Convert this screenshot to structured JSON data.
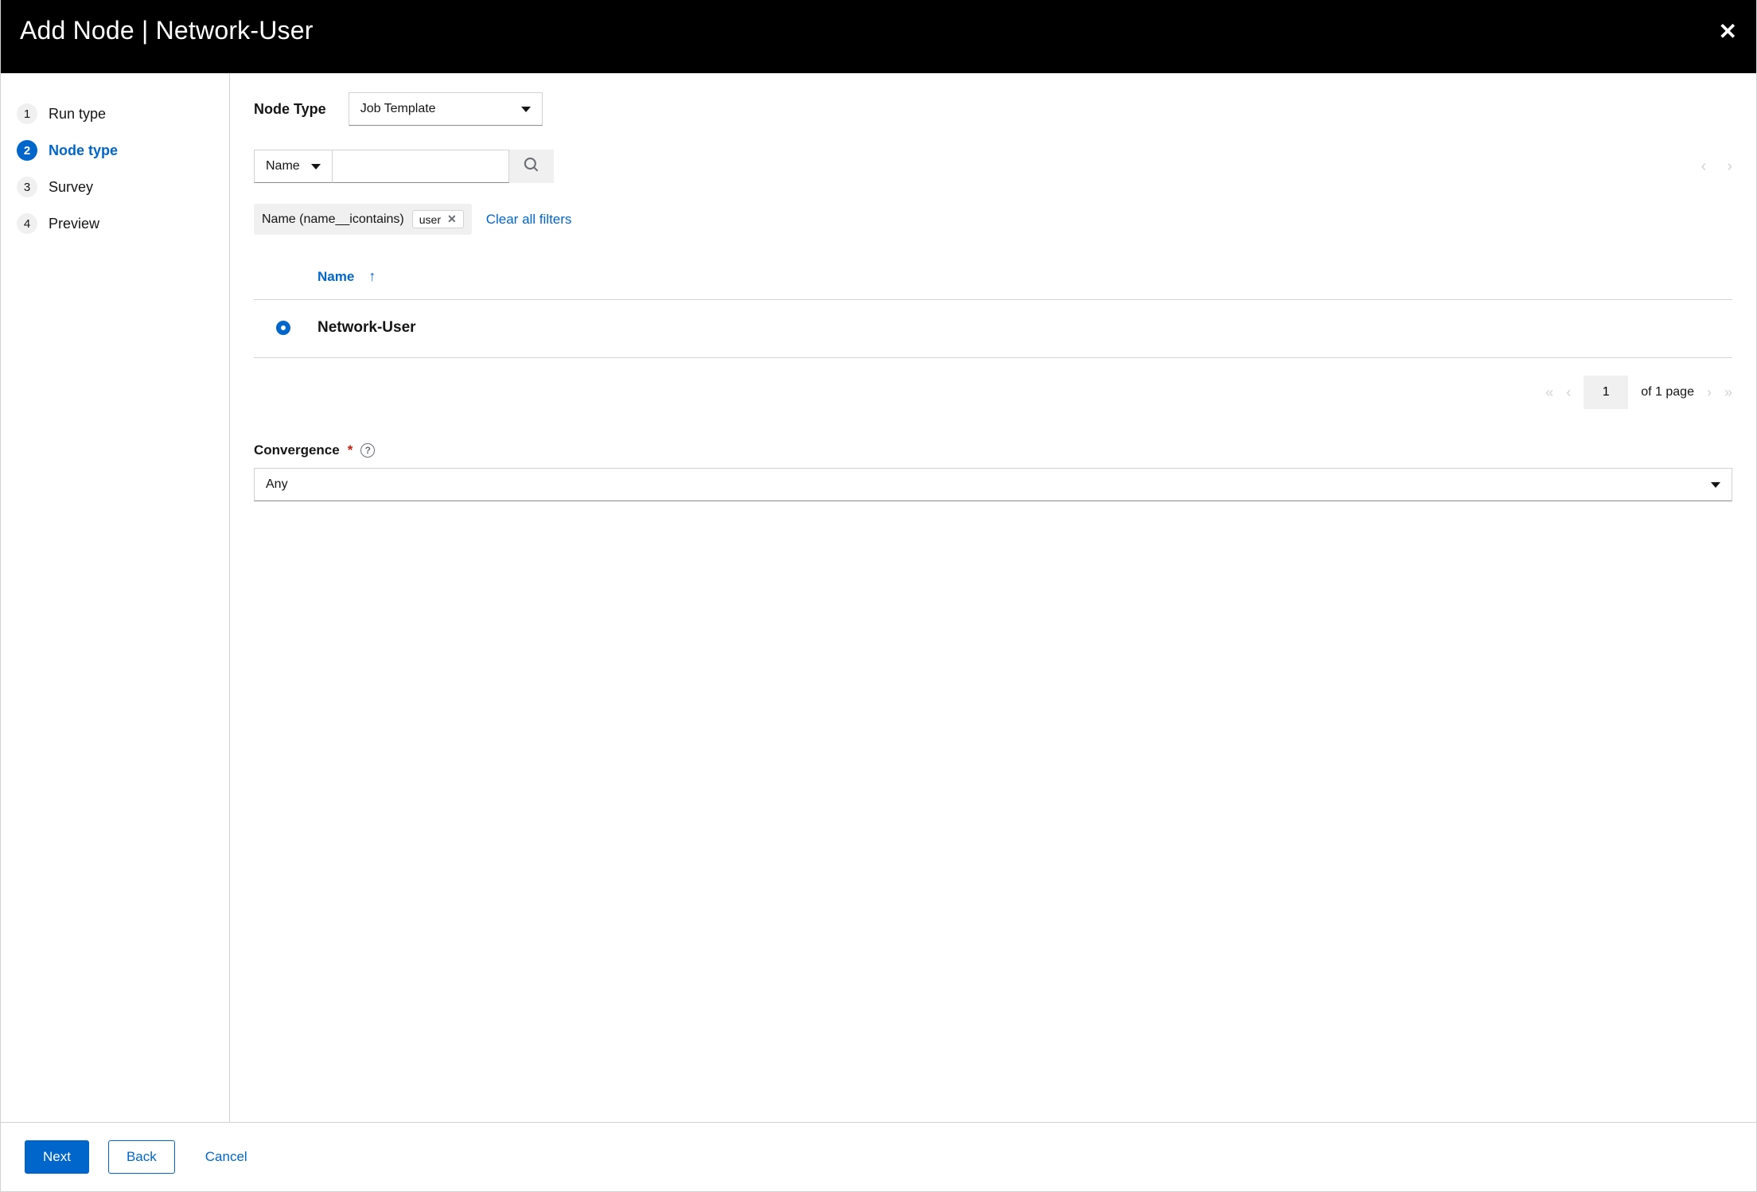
{
  "header": {
    "title": "Add Node | Network-User"
  },
  "wizard": {
    "steps": [
      {
        "num": "1",
        "label": "Run type"
      },
      {
        "num": "2",
        "label": "Node type"
      },
      {
        "num": "3",
        "label": "Survey"
      },
      {
        "num": "4",
        "label": "Preview"
      }
    ],
    "current_index": 1
  },
  "node_type": {
    "label": "Node Type",
    "value": "Job Template"
  },
  "search": {
    "key": "Name",
    "value": "",
    "placeholder": ""
  },
  "filter_chip": {
    "group_label": "Name (name__icontains)",
    "chip_value": "user",
    "clear_all": "Clear all filters"
  },
  "table": {
    "column_header": "Name",
    "rows": [
      {
        "name": "Network-User",
        "selected": true
      }
    ]
  },
  "pagination": {
    "current": "1",
    "suffix": "of 1 page"
  },
  "convergence": {
    "label": "Convergence",
    "value": "Any"
  },
  "footer": {
    "next": "Next",
    "back": "Back",
    "cancel": "Cancel"
  }
}
